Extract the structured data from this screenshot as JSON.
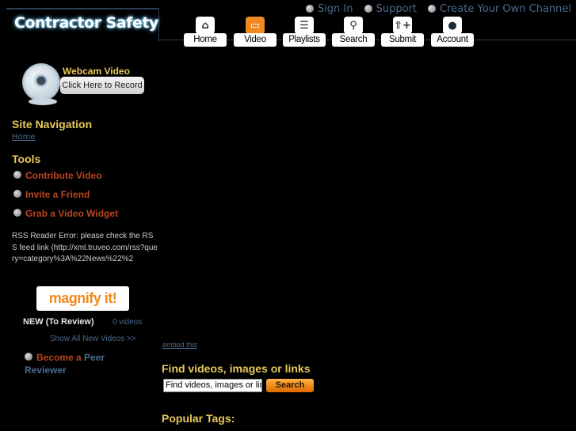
{
  "header": {
    "logo_text": "Contractor Safety",
    "top_links": [
      "Sign In",
      "Support",
      "Create Your Own Channel"
    ]
  },
  "nav": {
    "items": [
      {
        "label": "Home",
        "icon": "home-icon",
        "active": false
      },
      {
        "label": "Video",
        "icon": "tv-icon",
        "active": true
      },
      {
        "label": "Playlists",
        "icon": "list-icon",
        "active": false
      },
      {
        "label": "Search",
        "icon": "magnifier-icon",
        "active": false
      },
      {
        "label": "Submit",
        "icon": "upload-icon",
        "active": false
      },
      {
        "label": "Account",
        "icon": "user-icon",
        "active": false
      }
    ]
  },
  "sidebar": {
    "webcam_title": "Webcam Video",
    "webcam_button": "Click Here to Record",
    "site_nav_heading": "Site Navigation",
    "home_link": "Home",
    "tools_heading": "Tools",
    "tools": [
      "Contribute Video",
      "Invite a Friend",
      "Grab a Video Widget"
    ],
    "rss_error": "RSS Reader Error: please check the RSS feed link (http://xml.truveo.com/rss?query=category%3A%22News%22%2",
    "magnify_logo": "magnify it!",
    "new_label": "NEW (To Review)",
    "new_count": "0 videos",
    "show_all": "Show All New Videos >>",
    "peer_a": "Become a",
    "peer_b": "Peer Reviewer"
  },
  "main": {
    "embed_link": "embed this",
    "find_heading": "Find videos, images or links",
    "search_placeholder": "Find videos, images or links",
    "search_button": "Search",
    "popular_tags_heading": "Popular Tags:"
  },
  "colors": {
    "background": "#000000",
    "heading_yellow": "#e7c85a",
    "tool_orange": "#b8451f",
    "link_blue": "#4a6b8e",
    "accent_orange": "#f08a20"
  }
}
